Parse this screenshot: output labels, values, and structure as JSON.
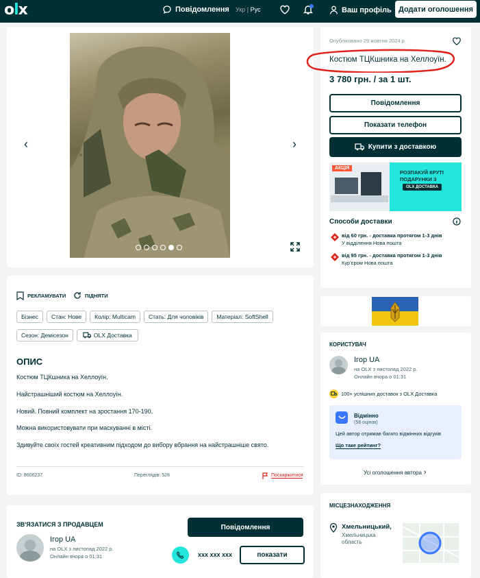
{
  "header": {
    "logo": "olx",
    "messages": "Повідомлення",
    "lang_ua": "Укр",
    "lang_sep": "|",
    "lang_ru": "Рус",
    "profile": "Ваш профіль",
    "post_ad": "Додати оголошення"
  },
  "listing": {
    "published": "Опубліковано 29 жовтня 2024 р.",
    "title": "Костюм ТЦКшника на Хеллоуїн.",
    "price": "3 780 грн. / за 1 шт.",
    "message_btn": "Повідомлення",
    "show_phone_btn": "Показати телефон",
    "buy_btn": "Купити з доставкою"
  },
  "promo": {
    "badge": "АКЦІЯ",
    "text": "РОЗПАКУЙ КРУТІ ПОДАРУНКИ З",
    "logo": "OLX ДОСТАВКА"
  },
  "delivery": {
    "title": "Способи доставки",
    "items": [
      {
        "price": "від 60 грн. - доставка протягом 1-3 днів",
        "desc": "У відділення Нова пошта"
      },
      {
        "price": "від 95 грн. - доставка протягом 1-3 днів",
        "desc": "Кур'єром Нова пошта"
      }
    ]
  },
  "actions": {
    "promote": "РЕКЛАМУВАТИ",
    "raise": "ПІДНЯТИ"
  },
  "tags": [
    "Бізнес",
    "Стан: Нове",
    "Колір: Multicam",
    "Стать: Для чоловіків",
    "Матеріал: SoftShell",
    "Сезон: Демісезон",
    "OLX Доставка"
  ],
  "description": {
    "heading": "ОПИС",
    "lines": [
      "Костюм ТЦКшника на Хеллоуїн.",
      "Найстрашніший костюм на Хеллоуїн.",
      "Новий. Повний комплект на зростання 170-190.",
      "Можна використовувати при маскуванні в місті.",
      "Здивуйте своїх гостей креативним підходом до вибору вбрання на найстрашніше свято."
    ]
  },
  "meta": {
    "id": "ID: 8606237",
    "views": "Переглядів: 528",
    "report": "Поскаржитися"
  },
  "contact": {
    "heading": "ЗВ'ЯЗАТИСЯ З ПРОДАВЦЕМ",
    "name": "Ігор UA",
    "since": "на OLX з листопад 2022 р.",
    "online": "Онлайн вчора о 01:31",
    "message_btn": "Повідомлення",
    "phone": "xxx xxx xxx",
    "show_btn": "показати"
  },
  "user": {
    "heading": "КОРИСТУВАЧ",
    "name": "Ігор UA",
    "since": "на OLX з листопад 2022 р.",
    "online": "Онлайн вчора о 01:31",
    "deliveries": "100+ успішних доставок з OLX Доставка",
    "rating_title": "Відмінно",
    "rating_count": "(58 оцінок)",
    "rating_text": "Цей автор отримав багато відмінних відгуків",
    "rating_link": "Що таке рейтинг?",
    "all_ads": "Усі оголошення автора"
  },
  "location": {
    "heading": "МІСЦЕЗНАХОДЖЕННЯ",
    "city": "Хмельницький,",
    "region": "Хмельницька",
    "region2": "область"
  },
  "colors": {
    "brand": "#002f34",
    "accent": "#23e5db",
    "highlight": "#e0201a"
  }
}
